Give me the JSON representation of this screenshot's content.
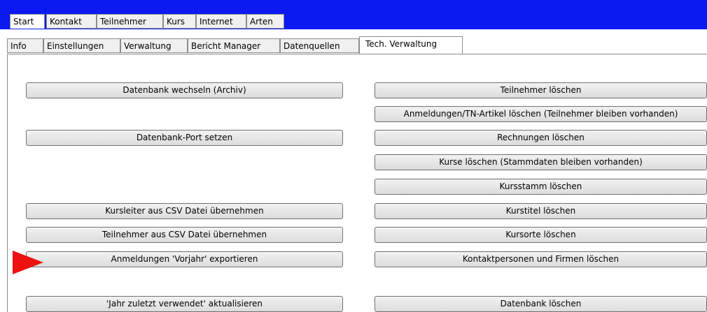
{
  "main_tabs": [
    "Start",
    "Kontakt",
    "Teilnehmer",
    "Kurs",
    "Internet",
    "Arten"
  ],
  "sub_tabs": [
    "Info",
    "Einstellungen",
    "Verwaltung",
    "Bericht Manager",
    "Datenquellen",
    "Tech. Verwaltung"
  ],
  "left_buttons": [
    "Datenbank wechseln (Archiv)",
    "Datenbank-Port setzen",
    "Kursleiter aus CSV Datei übernehmen",
    "Teilnehmer aus CSV Datei übernehmen",
    "Anmeldungen 'Vorjahr' exportieren",
    "'Jahr zuletzt verwendet' aktualisieren"
  ],
  "right_buttons": [
    "Teilnehmer löschen",
    "Anmeldungen/TN-Artikel löschen (Teilnehmer bleiben vorhanden)",
    "Rechnungen löschen",
    "Kurse löschen (Stammdaten bleiben vorhanden)",
    "Kursstamm löschen",
    "Kurstitel löschen",
    "Kursorte löschen",
    "Kontaktpersonen und Firmen löschen",
    "Datenbank löschen"
  ],
  "colors": {
    "title_bar": "#0b1af0",
    "marker_arrow": "#ee1111"
  }
}
